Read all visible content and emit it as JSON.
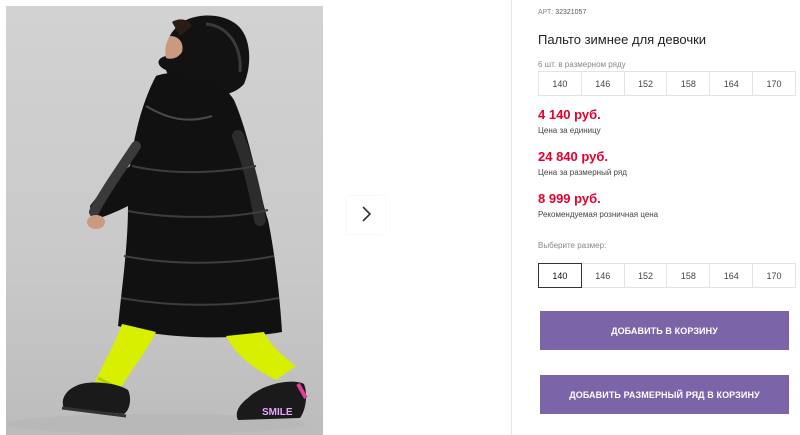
{
  "product": {
    "sku_label": "АРТ:",
    "sku": "32321057",
    "title": "Пальто зимнее для девочки",
    "set_note": "6 шт. в размерном ряду",
    "sizes_in_set": [
      "140",
      "146",
      "152",
      "158",
      "164",
      "170"
    ]
  },
  "prices": [
    {
      "value": "4 140 руб.",
      "label": "Цена за единицу"
    },
    {
      "value": "24 840 руб.",
      "label": "Цена за размерный ряд"
    },
    {
      "value": "8 999 руб.",
      "label": "Рекомендуемая розничная цена"
    }
  ],
  "size_picker": {
    "label": "Выберите размер:",
    "sizes": [
      "140",
      "146",
      "152",
      "158",
      "164",
      "170"
    ],
    "selected": "140"
  },
  "buttons": {
    "add_to_cart": "ДОБАВИТЬ В КОРЗИНУ",
    "add_set_to_cart": "ДОБАВИТЬ РАЗМЕРНЫЙ РЯД В КОРЗИНУ"
  },
  "gallery": {
    "next_icon": "chevron-right-icon",
    "shoe_text": "SMILE"
  },
  "colors": {
    "price": "#e4002b",
    "button": "#7b64a8",
    "coat": "#111111",
    "pants": "#d8f000"
  }
}
